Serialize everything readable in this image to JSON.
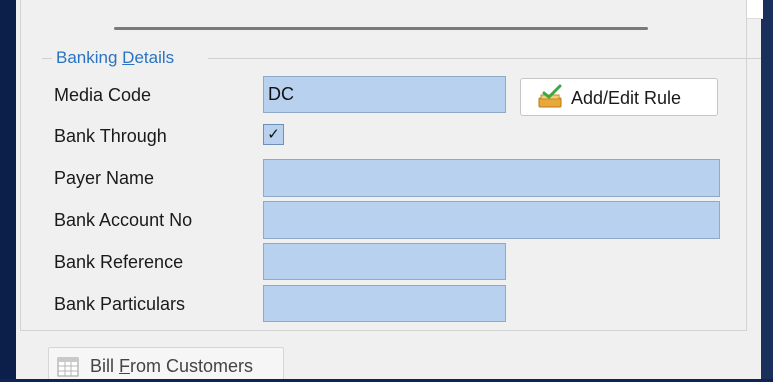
{
  "banking": {
    "title_pre": "Banking ",
    "title_mnemonic": "D",
    "title_post": "etails",
    "media_code_label": "Media Code",
    "media_code_value": "DC",
    "bank_through_label": "Bank Through",
    "bank_through_checked": true,
    "bank_through_mark": "✓",
    "payer_name_label": "Payer Name",
    "payer_name_value": "",
    "bank_account_label": "Bank Account No",
    "bank_account_value": "",
    "bank_reference_label": "Bank Reference",
    "bank_reference_value": "",
    "bank_particulars_label": "Bank Particulars",
    "bank_particulars_value": "",
    "add_edit_rule_label": "Add/Edit Rule"
  },
  "tab": {
    "label_pre": "Bill ",
    "label_mnemonic": "F",
    "label_post": "rom Customers"
  },
  "colors": {
    "field_bg": "#b7d1ef",
    "group_title": "#2a73c2",
    "desktop_bg": "#0e2452"
  }
}
